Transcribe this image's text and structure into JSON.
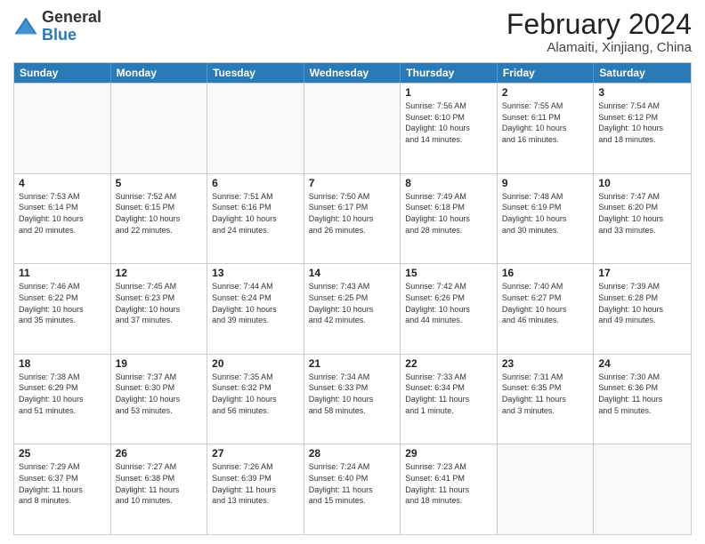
{
  "header": {
    "logo_general": "General",
    "logo_blue": "Blue",
    "title": "February 2024",
    "location": "Alamaiti, Xinjiang, China"
  },
  "days_of_week": [
    "Sunday",
    "Monday",
    "Tuesday",
    "Wednesday",
    "Thursday",
    "Friday",
    "Saturday"
  ],
  "weeks": [
    [
      {
        "day": "",
        "info": ""
      },
      {
        "day": "",
        "info": ""
      },
      {
        "day": "",
        "info": ""
      },
      {
        "day": "",
        "info": ""
      },
      {
        "day": "1",
        "info": "Sunrise: 7:56 AM\nSunset: 6:10 PM\nDaylight: 10 hours\nand 14 minutes."
      },
      {
        "day": "2",
        "info": "Sunrise: 7:55 AM\nSunset: 6:11 PM\nDaylight: 10 hours\nand 16 minutes."
      },
      {
        "day": "3",
        "info": "Sunrise: 7:54 AM\nSunset: 6:12 PM\nDaylight: 10 hours\nand 18 minutes."
      }
    ],
    [
      {
        "day": "4",
        "info": "Sunrise: 7:53 AM\nSunset: 6:14 PM\nDaylight: 10 hours\nand 20 minutes."
      },
      {
        "day": "5",
        "info": "Sunrise: 7:52 AM\nSunset: 6:15 PM\nDaylight: 10 hours\nand 22 minutes."
      },
      {
        "day": "6",
        "info": "Sunrise: 7:51 AM\nSunset: 6:16 PM\nDaylight: 10 hours\nand 24 minutes."
      },
      {
        "day": "7",
        "info": "Sunrise: 7:50 AM\nSunset: 6:17 PM\nDaylight: 10 hours\nand 26 minutes."
      },
      {
        "day": "8",
        "info": "Sunrise: 7:49 AM\nSunset: 6:18 PM\nDaylight: 10 hours\nand 28 minutes."
      },
      {
        "day": "9",
        "info": "Sunrise: 7:48 AM\nSunset: 6:19 PM\nDaylight: 10 hours\nand 30 minutes."
      },
      {
        "day": "10",
        "info": "Sunrise: 7:47 AM\nSunset: 6:20 PM\nDaylight: 10 hours\nand 33 minutes."
      }
    ],
    [
      {
        "day": "11",
        "info": "Sunrise: 7:46 AM\nSunset: 6:22 PM\nDaylight: 10 hours\nand 35 minutes."
      },
      {
        "day": "12",
        "info": "Sunrise: 7:45 AM\nSunset: 6:23 PM\nDaylight: 10 hours\nand 37 minutes."
      },
      {
        "day": "13",
        "info": "Sunrise: 7:44 AM\nSunset: 6:24 PM\nDaylight: 10 hours\nand 39 minutes."
      },
      {
        "day": "14",
        "info": "Sunrise: 7:43 AM\nSunset: 6:25 PM\nDaylight: 10 hours\nand 42 minutes."
      },
      {
        "day": "15",
        "info": "Sunrise: 7:42 AM\nSunset: 6:26 PM\nDaylight: 10 hours\nand 44 minutes."
      },
      {
        "day": "16",
        "info": "Sunrise: 7:40 AM\nSunset: 6:27 PM\nDaylight: 10 hours\nand 46 minutes."
      },
      {
        "day": "17",
        "info": "Sunrise: 7:39 AM\nSunset: 6:28 PM\nDaylight: 10 hours\nand 49 minutes."
      }
    ],
    [
      {
        "day": "18",
        "info": "Sunrise: 7:38 AM\nSunset: 6:29 PM\nDaylight: 10 hours\nand 51 minutes."
      },
      {
        "day": "19",
        "info": "Sunrise: 7:37 AM\nSunset: 6:30 PM\nDaylight: 10 hours\nand 53 minutes."
      },
      {
        "day": "20",
        "info": "Sunrise: 7:35 AM\nSunset: 6:32 PM\nDaylight: 10 hours\nand 56 minutes."
      },
      {
        "day": "21",
        "info": "Sunrise: 7:34 AM\nSunset: 6:33 PM\nDaylight: 10 hours\nand 58 minutes."
      },
      {
        "day": "22",
        "info": "Sunrise: 7:33 AM\nSunset: 6:34 PM\nDaylight: 11 hours\nand 1 minute."
      },
      {
        "day": "23",
        "info": "Sunrise: 7:31 AM\nSunset: 6:35 PM\nDaylight: 11 hours\nand 3 minutes."
      },
      {
        "day": "24",
        "info": "Sunrise: 7:30 AM\nSunset: 6:36 PM\nDaylight: 11 hours\nand 5 minutes."
      }
    ],
    [
      {
        "day": "25",
        "info": "Sunrise: 7:29 AM\nSunset: 6:37 PM\nDaylight: 11 hours\nand 8 minutes."
      },
      {
        "day": "26",
        "info": "Sunrise: 7:27 AM\nSunset: 6:38 PM\nDaylight: 11 hours\nand 10 minutes."
      },
      {
        "day": "27",
        "info": "Sunrise: 7:26 AM\nSunset: 6:39 PM\nDaylight: 11 hours\nand 13 minutes."
      },
      {
        "day": "28",
        "info": "Sunrise: 7:24 AM\nSunset: 6:40 PM\nDaylight: 11 hours\nand 15 minutes."
      },
      {
        "day": "29",
        "info": "Sunrise: 7:23 AM\nSunset: 6:41 PM\nDaylight: 11 hours\nand 18 minutes."
      },
      {
        "day": "",
        "info": ""
      },
      {
        "day": "",
        "info": ""
      }
    ]
  ]
}
